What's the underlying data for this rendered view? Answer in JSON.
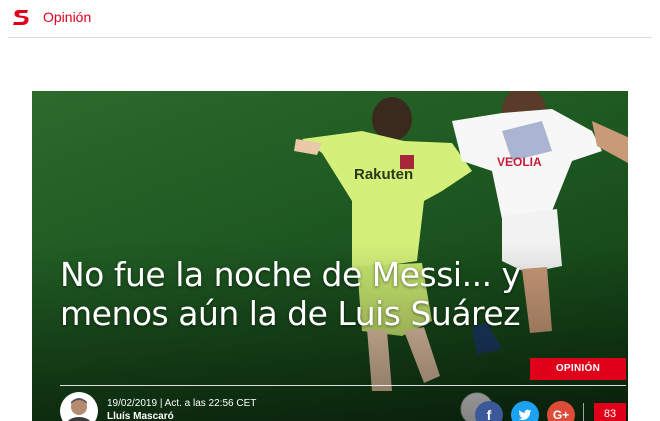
{
  "header": {
    "logo_letter": "S",
    "section_title": "Opinión",
    "brand_color": "#e1001a"
  },
  "article": {
    "headline": "No fue la noche de Messi... y menos aún la de Luis Suárez",
    "category_badge": "OPINIÓN",
    "date_line": "19/02/2019 | Act. a las 22:56 CET",
    "author": "Lluís Mascaró",
    "comment_count": "83"
  },
  "photo": {
    "jersey_left_sponsor": "Rakuten",
    "jersey_right_sponsor": "VEOLIA"
  },
  "share": {
    "facebook_icon": "f",
    "twitter_icon": "bird",
    "googleplus_icon": "G+"
  }
}
